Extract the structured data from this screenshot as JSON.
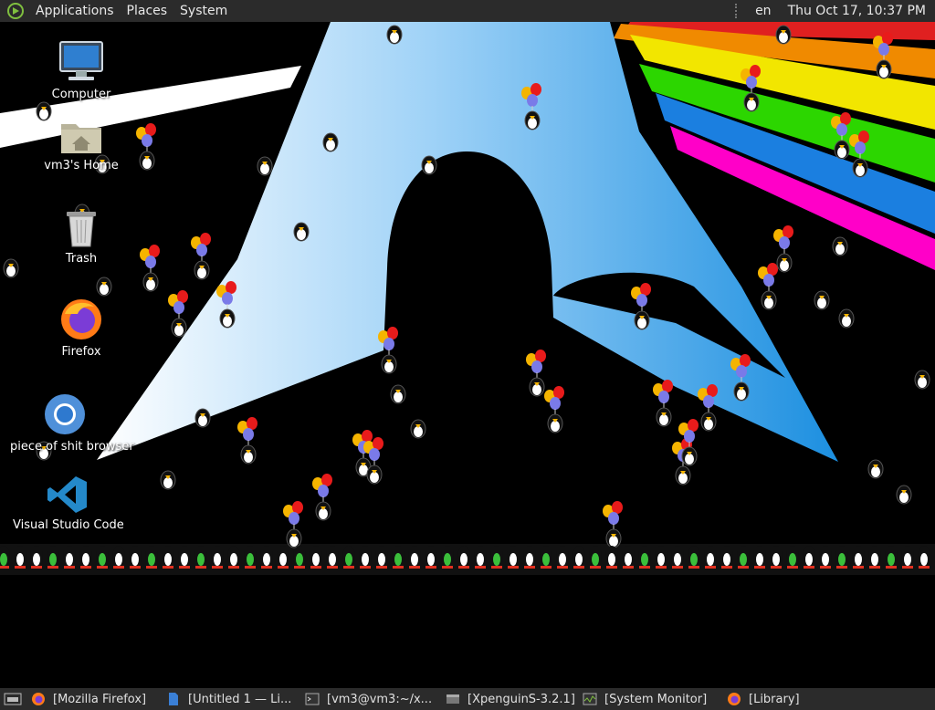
{
  "top_panel": {
    "menus": [
      "Applications",
      "Places",
      "System"
    ],
    "language": "en",
    "clock": "Thu Oct 17, 10:37 PM"
  },
  "desktop_icons": [
    {
      "label": "Computer",
      "icon": "computer-icon"
    },
    {
      "label": "vm3's Home",
      "icon": "home-folder-icon"
    },
    {
      "label": "Trash",
      "icon": "trash-icon"
    },
    {
      "label": "Firefox",
      "icon": "firefox-icon"
    },
    {
      "label": "piece of shit browser",
      "icon": "chromium-icon"
    },
    {
      "label": "Visual Studio Code",
      "icon": "vscode-icon"
    }
  ],
  "taskbar": [
    {
      "label": "[Mozilla Firefox]",
      "icon": "firefox-icon"
    },
    {
      "label": "[Untitled 1 — Li...",
      "icon": "libreoffice-icon"
    },
    {
      "label": "[vm3@vm3:~/x...",
      "icon": "terminal-icon"
    },
    {
      "label": "[XpenguinS-3.2.1]",
      "icon": "window-icon"
    },
    {
      "label": "[System Monitor]",
      "icon": "system-monitor-icon"
    },
    {
      "label": "[Library]",
      "icon": "firefox-icon"
    }
  ],
  "colors": {
    "panel": "#2b2b2b",
    "arch_blue": "#1c8fe0",
    "rainbow": [
      "#e02020",
      "#f08a00",
      "#f2e600",
      "#2cd600",
      "#1b7fe0",
      "#ff00c8"
    ]
  }
}
